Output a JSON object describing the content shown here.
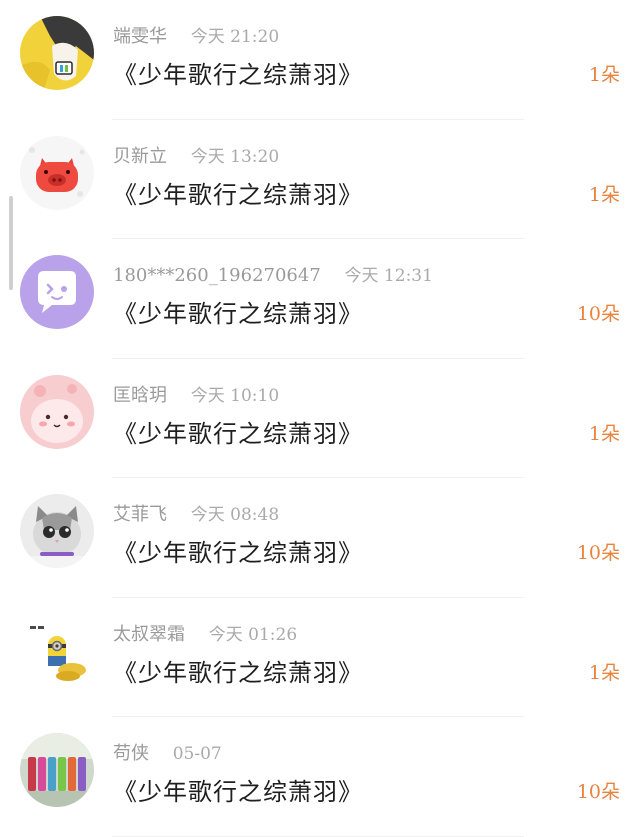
{
  "gift_list": [
    {
      "user": "端雯华",
      "time": "今天  21:20",
      "item": "《少年歌行之综萧羽》",
      "count": "1朵",
      "avatar_icon": "anime-boy-avatar"
    },
    {
      "user": "贝新立",
      "time": "今天  13:20",
      "item": "《少年歌行之综萧羽》",
      "count": "1朵",
      "avatar_icon": "red-pig-avatar"
    },
    {
      "user": "180***260_196270647",
      "time": "今天  12:31",
      "item": "《少年歌行之综萧羽》",
      "count": "10朵",
      "avatar_icon": "purple-chat-avatar"
    },
    {
      "user": "匡晗玥",
      "time": "今天  10:10",
      "item": "《少年歌行之综萧羽》",
      "count": "1朵",
      "avatar_icon": "pink-blob-avatar"
    },
    {
      "user": "艾菲飞",
      "time": "今天  08:48",
      "item": "《少年歌行之综萧羽》",
      "count": "10朵",
      "avatar_icon": "cat-avatar"
    },
    {
      "user": "太叔翠霜",
      "time": "今天  01:26",
      "item": "《少年歌行之综萧羽》",
      "count": "1朵",
      "avatar_icon": "minion-avatar"
    },
    {
      "user": "苟侠",
      "time": "05-07",
      "item": "《少年歌行之综萧羽》",
      "count": "10朵",
      "avatar_icon": "bottles-avatar"
    }
  ],
  "colors": {
    "accent": "#e8843f",
    "meta_text": "#9a9a9a",
    "title_text": "#1f1f1f"
  }
}
